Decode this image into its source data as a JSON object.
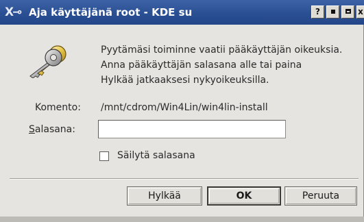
{
  "window": {
    "title": "Aja käyttäjänä root - KDE su",
    "titlebar_buttons": {
      "help": "?",
      "minimize_icon": "minimize-icon",
      "maximize_icon": "maximize-icon",
      "close": "x"
    }
  },
  "dialog": {
    "icon": "keys-icon",
    "message_lines": [
      "Pyytämäsi toiminne vaatii pääkäyttäjän oikeuksia.",
      "Anna pääkäyttäjän salasana alle tai paina",
      "Hylkää jatkaaksesi nykyoikeuksilla."
    ],
    "command_label": "Komento:",
    "command_value": "/mnt/cdrom/Win4Lin/win4lin-install",
    "password_label_prefix": "S",
    "password_label_rest": "alasana:",
    "password_value": "",
    "remember_checked": false,
    "remember_label": "Säilytä salasana"
  },
  "buttons": {
    "ignore": "Hylkää",
    "ok": "OK",
    "cancel": "Peruuta"
  },
  "colors": {
    "titlebar": "#2a4f93",
    "dialog_bg": "#e6e4e0"
  }
}
